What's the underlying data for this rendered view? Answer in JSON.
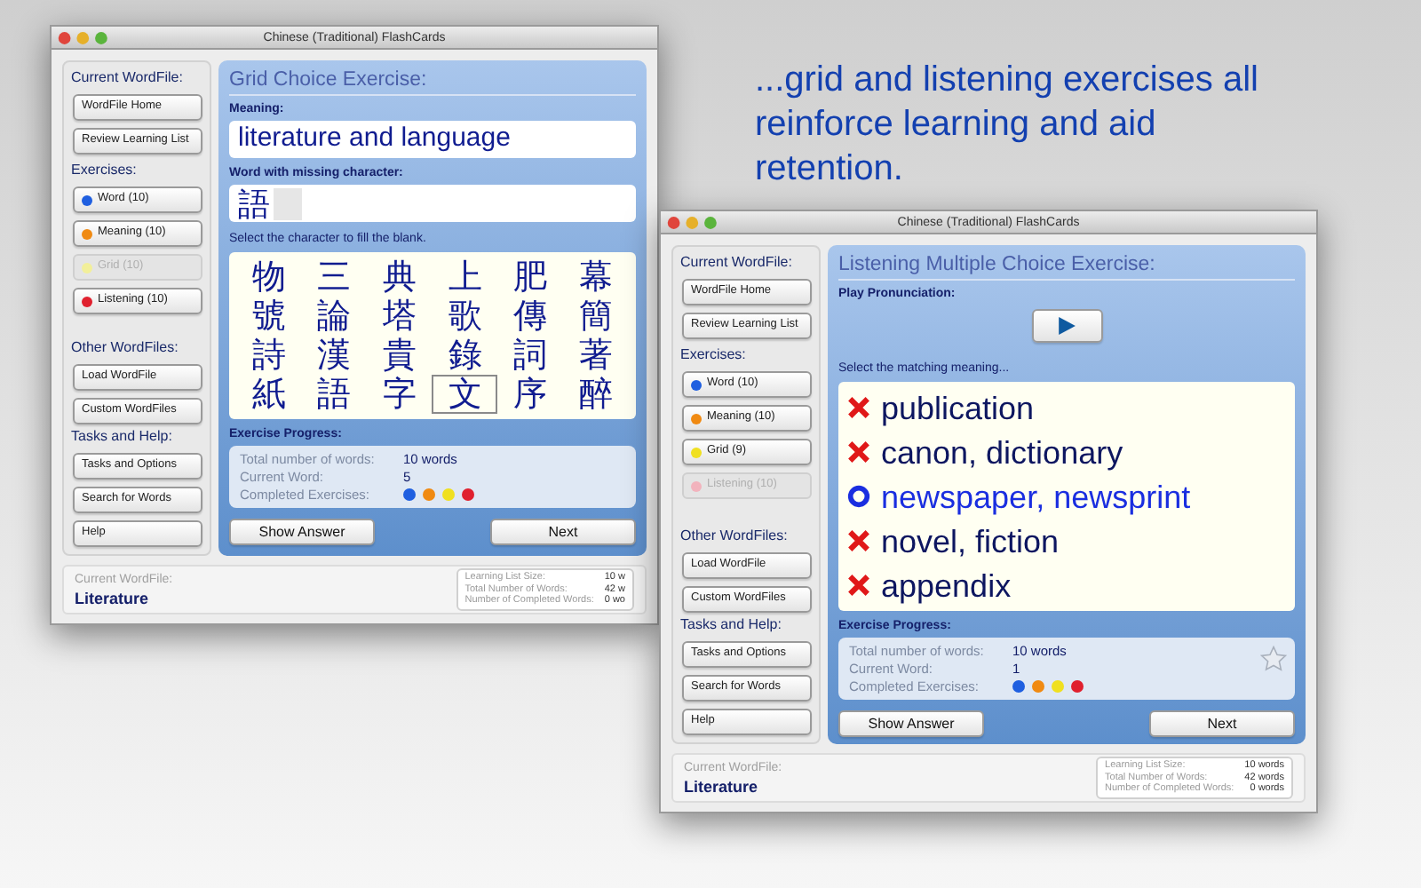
{
  "headline": "...grid and listening exercises all reinforce learning and aid retention.",
  "windows": [
    {
      "title": "Chinese (Traditional) FlashCards",
      "sidebar": [
        {
          "heading": "Current WordFile:",
          "buttons": [
            {
              "label": "WordFile Home"
            },
            {
              "label": "Review Learning List"
            }
          ]
        },
        {
          "heading": "Exercises:",
          "buttons": [
            {
              "label": "Word (10)",
              "color": "#1f5fe0",
              "disabled": false
            },
            {
              "label": "Meaning (10)",
              "color": "#f08a12",
              "disabled": false
            },
            {
              "label": "Grid (10)",
              "color": "#f2ef9a",
              "disabled": true
            },
            {
              "label": "Listening (10)",
              "color": "#e0202e",
              "disabled": false
            }
          ]
        },
        {
          "heading": "Other WordFiles:",
          "buttons": [
            {
              "label": "Load WordFile"
            },
            {
              "label": "Custom WordFiles"
            }
          ]
        },
        {
          "heading": "Tasks and Help:",
          "buttons": [
            {
              "label": "Tasks and Options"
            },
            {
              "label": "Search for Words"
            },
            {
              "label": "Help"
            }
          ]
        }
      ],
      "exercise": {
        "kind": "grid",
        "title": "Grid Choice Exercise:",
        "meaning_label": "Meaning:",
        "meaning": "literature and language",
        "word_label": "Word with missing character:",
        "word": "語",
        "prompt": "Select the character to fill the blank.",
        "grid": [
          [
            {
              "char": "物",
              "selected": false
            },
            {
              "char": "三",
              "selected": false
            },
            {
              "char": "典",
              "selected": false
            },
            {
              "char": "上",
              "selected": false
            },
            {
              "char": "肥",
              "selected": false
            },
            {
              "char": "幕",
              "selected": false
            }
          ],
          [
            {
              "char": "號",
              "selected": false
            },
            {
              "char": "論",
              "selected": false
            },
            {
              "char": "塔",
              "selected": false
            },
            {
              "char": "歌",
              "selected": false
            },
            {
              "char": "傳",
              "selected": false
            },
            {
              "char": "簡",
              "selected": false
            }
          ],
          [
            {
              "char": "詩",
              "selected": false
            },
            {
              "char": "漢",
              "selected": false
            },
            {
              "char": "貴",
              "selected": false
            },
            {
              "char": "錄",
              "selected": false
            },
            {
              "char": "詞",
              "selected": false
            },
            {
              "char": "著",
              "selected": false
            }
          ],
          [
            {
              "char": "紙",
              "selected": false
            },
            {
              "char": "語",
              "selected": false
            },
            {
              "char": "字",
              "selected": false
            },
            {
              "char": "文",
              "selected": true
            },
            {
              "char": "序",
              "selected": false
            },
            {
              "char": "醉",
              "selected": false
            }
          ]
        ]
      },
      "progress": {
        "heading": "Exercise Progress:",
        "total_label": "Total number of words:",
        "total": "10 words",
        "current_label": "Current Word:",
        "current": "5",
        "completed_label": "Completed Exercises:",
        "completed": [
          {
            "color": "#1f5fe0"
          },
          {
            "color": "#f08a12"
          },
          {
            "color": "#f0e020"
          },
          {
            "color": "#e0202e"
          }
        ]
      },
      "buttons": [
        "Show Answer",
        "Next"
      ],
      "status": {
        "label": "Current WordFile:",
        "wordfile": "Literature",
        "stats": [
          {
            "label": "Learning List Size:",
            "value": "10 w"
          },
          {
            "label": "Total Number of Words:",
            "value": "42 w"
          },
          {
            "label": "Number of Completed Words:",
            "value": "0 wo"
          }
        ]
      }
    },
    {
      "title": "Chinese (Traditional) FlashCards",
      "sidebar": [
        {
          "heading": "Current WordFile:",
          "buttons": [
            {
              "label": "WordFile Home"
            },
            {
              "label": "Review Learning List"
            }
          ]
        },
        {
          "heading": "Exercises:",
          "buttons": [
            {
              "label": "Word (10)",
              "color": "#1f5fe0",
              "disabled": false
            },
            {
              "label": "Meaning (10)",
              "color": "#f08a12",
              "disabled": false
            },
            {
              "label": "Grid (9)",
              "color": "#f0e020",
              "disabled": false
            },
            {
              "label": "Listening (10)",
              "color": "#f2b3bd",
              "disabled": true
            }
          ]
        },
        {
          "heading": "Other WordFiles:",
          "buttons": [
            {
              "label": "Load WordFile"
            },
            {
              "label": "Custom WordFiles"
            }
          ]
        },
        {
          "heading": "Tasks and Help:",
          "buttons": [
            {
              "label": "Tasks and Options"
            },
            {
              "label": "Search for Words"
            },
            {
              "label": "Help"
            }
          ]
        }
      ],
      "exercise": {
        "kind": "listening",
        "title": "Listening Multiple Choice Exercise:",
        "play_label": "Play Pronunciation:",
        "prompt": "Select the matching meaning...",
        "choices": [
          {
            "text": "publication",
            "correct": false
          },
          {
            "text": "canon, dictionary",
            "correct": false
          },
          {
            "text": "newspaper, newsprint",
            "correct": true
          },
          {
            "text": "novel, fiction",
            "correct": false
          },
          {
            "text": "appendix",
            "correct": false
          }
        ]
      },
      "progress": {
        "heading": "Exercise Progress:",
        "total_label": "Total number of words:",
        "total": "10 words",
        "current_label": "Current Word:",
        "current": "1",
        "completed_label": "Completed Exercises:",
        "completed": [
          {
            "color": "#1f5fe0"
          },
          {
            "color": "#f08a12"
          },
          {
            "color": "#f0e020"
          },
          {
            "color": "#e0202e"
          }
        ],
        "star": {
          "filled": false
        }
      },
      "buttons": [
        "Show Answer",
        "Next"
      ],
      "status": {
        "label": "Current WordFile:",
        "wordfile": "Literature",
        "stats": [
          {
            "label": "Learning List Size:",
            "value": "10 words"
          },
          {
            "label": "Total Number of Words:",
            "value": "42 words"
          },
          {
            "label": "Number of Completed Words:",
            "value": "0 words"
          }
        ]
      }
    }
  ]
}
